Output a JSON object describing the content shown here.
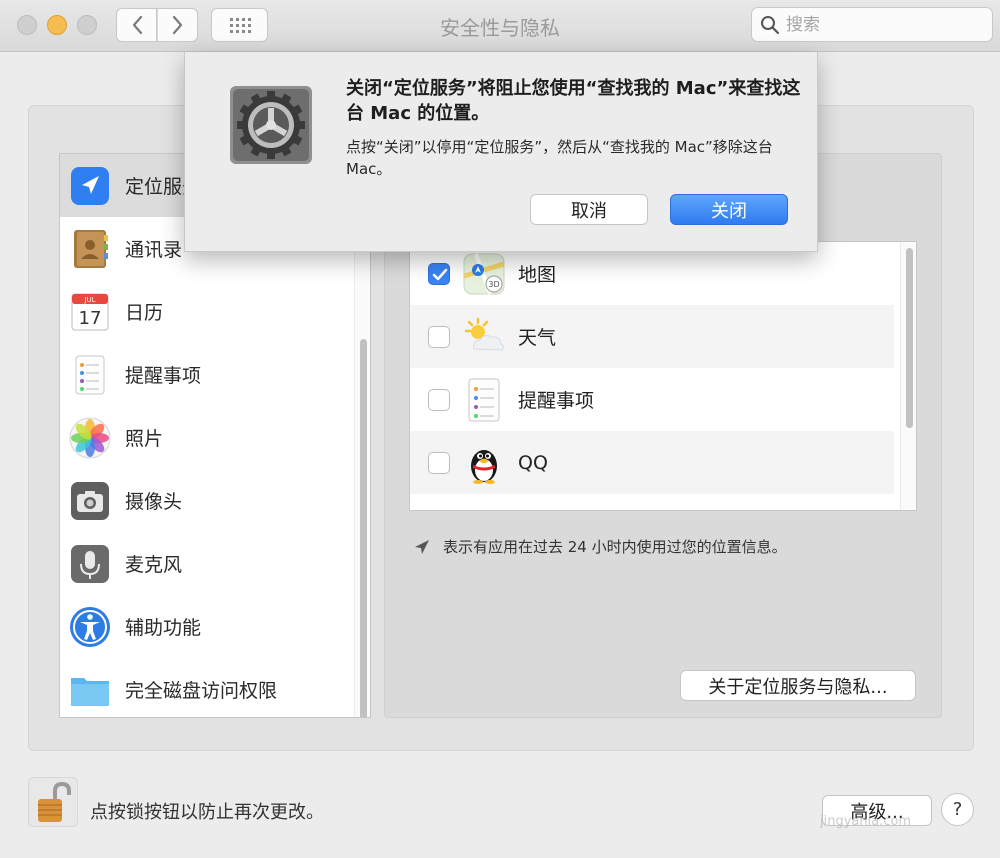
{
  "window": {
    "title": "安全性与隐私",
    "search_placeholder": "搜索"
  },
  "colors": {
    "accent": "#3a84f5",
    "selected_row": "#dcdcdc"
  },
  "sidebar": {
    "selected_index": 0,
    "items": [
      {
        "label": "定位服务",
        "icon": "location-arrow-icon"
      },
      {
        "label": "通讯录",
        "icon": "contacts-book-icon"
      },
      {
        "label": "日历",
        "icon": "calendar-icon"
      },
      {
        "label": "提醒事项",
        "icon": "reminders-icon"
      },
      {
        "label": "照片",
        "icon": "photos-icon"
      },
      {
        "label": "摄像头",
        "icon": "camera-icon"
      },
      {
        "label": "麦克风",
        "icon": "microphone-icon"
      },
      {
        "label": "辅助功能",
        "icon": "accessibility-icon"
      },
      {
        "label": "完全磁盘访问权限",
        "icon": "folder-icon"
      }
    ]
  },
  "apps": {
    "items": [
      {
        "label": "地图",
        "checked": true,
        "icon": "maps-icon"
      },
      {
        "label": "天气",
        "checked": false,
        "icon": "weather-icon"
      },
      {
        "label": "提醒事项",
        "checked": false,
        "icon": "reminders-icon"
      },
      {
        "label": "QQ",
        "checked": false,
        "icon": "qq-penguin-icon"
      }
    ]
  },
  "hint_text": "表示有应用在过去 24 小时内使用过您的位置信息。",
  "about_button": "关于定位服务与隐私...",
  "bottom": {
    "lock_text": "点按锁按钮以防止再次更改。",
    "advanced_button": "高级...",
    "help_button": "?"
  },
  "sheet": {
    "title": "关闭“定位服务”将阻止您使用“查找我的 Mac”来查找这台 Mac 的位置。",
    "message": "点按“关闭”以停用“定位服务”，然后从“查找我的 Mac”移除这台 Mac。",
    "cancel_label": "取消",
    "close_label": "关闭"
  },
  "watermark": "jingyanla.com"
}
